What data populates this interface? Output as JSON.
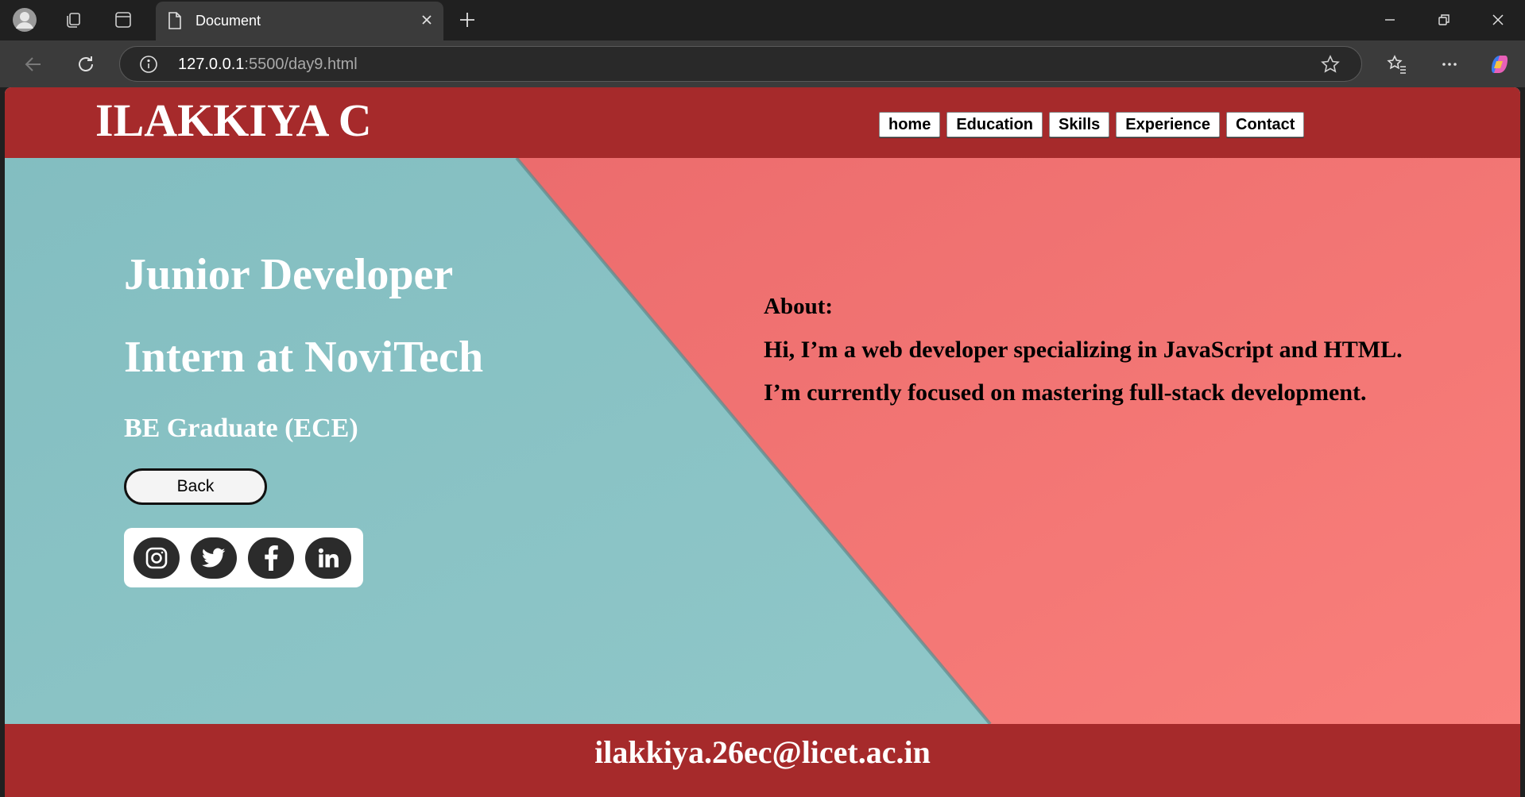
{
  "browser": {
    "tab_title": "Document",
    "url_host": "127.0.0.1",
    "url_path": ":5500/day9.html"
  },
  "site": {
    "logo": "ILAKKIYA C",
    "nav": [
      "home",
      "Education",
      "Skills",
      "Experience",
      "Contact"
    ],
    "headline_1": "Junior Developer",
    "headline_2": "Intern at NoviTech",
    "subheadline": "BE Graduate (ECE)",
    "back_label": "Back",
    "socials": [
      "instagram-icon",
      "twitter-icon",
      "facebook-icon",
      "linkedin-icon"
    ],
    "about_title": "About:",
    "about_line_1": "Hi, I’m a web developer specializing in JavaScript and HTML.",
    "about_line_2": "I’m currently focused on mastering full-stack development.",
    "footer_email": "ilakkiya.26ec@licet.ac.in"
  },
  "colors": {
    "brand": "#a62a2b",
    "teal": "#8cc5c6",
    "coral": "#f47a78"
  }
}
